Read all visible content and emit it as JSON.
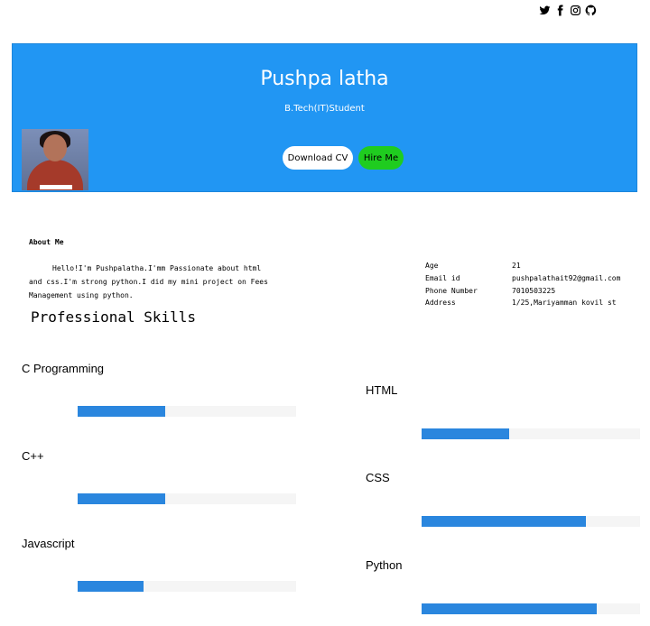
{
  "social": [
    "twitter-icon",
    "facebook-icon",
    "instagram-icon",
    "github-icon"
  ],
  "hero": {
    "name": "Pushpa latha",
    "role": "B.Tech(IT)Student",
    "download_cv": "Download CV",
    "hire_me": "Hire Me"
  },
  "about": {
    "heading": "About Me",
    "text": "Hello!I'm Pushpalatha.I'mm Passionate about html and css.I'm strong python.I did my mini project on Fees Management using python."
  },
  "info": [
    {
      "label": "Age",
      "value": "21"
    },
    {
      "label": "Email id",
      "value": "pushpalathait92@gmail.com"
    },
    {
      "label": "Phone Number",
      "value": "7010503225"
    },
    {
      "label": "Address",
      "value": "1/25,Mariyamman kovil st"
    }
  ],
  "skills_heading": "Professional Skills",
  "skills_left": [
    {
      "name": "C Programming",
      "level": 0.4
    },
    {
      "name": "C++",
      "level": 0.4
    },
    {
      "name": "Javascript",
      "level": 0.3
    }
  ],
  "skills_right": [
    {
      "name": "HTML",
      "level": 0.4
    },
    {
      "name": "CSS",
      "level": 0.75
    },
    {
      "name": "Python",
      "level": 0.8
    }
  ],
  "colors": {
    "hero": "#2196f3",
    "hire": "#1fcc1f",
    "bar": "#2a86de"
  }
}
